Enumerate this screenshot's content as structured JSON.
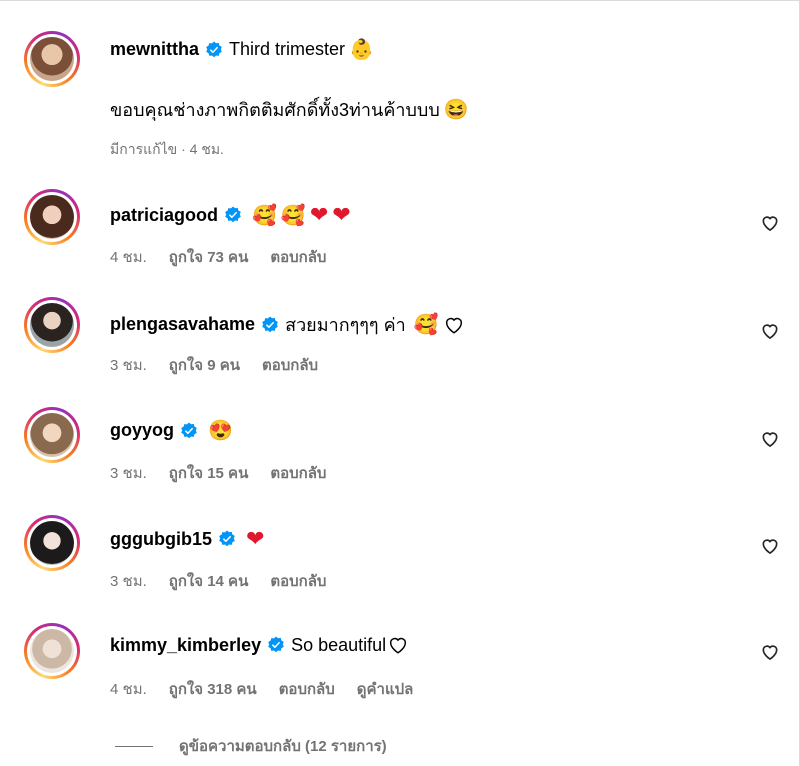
{
  "post": {
    "username": "mewnittha",
    "caption_title": "Third trimester",
    "caption_emoji": "👶",
    "caption_body": "ขอบคุณช่างภาพกิตติมศักดิ์ทั้ง3ท่านค้าบบบ",
    "caption_body_emoji": "😆",
    "edited_label": "มีการแก้ไข · 4 ชม."
  },
  "comments": [
    {
      "username": "patriciagood",
      "text": "",
      "emojis": [
        "🥰",
        "🥰"
      ],
      "hearts_red": 2,
      "hearts_outline": 0,
      "time": "4 ชม.",
      "likes": "ถูกใจ 73 คน",
      "reply": "ตอบกลับ",
      "translate": ""
    },
    {
      "username": "plengasavahame",
      "text": "สวยมากๆๆๆ ค่า",
      "emojis": [
        "🥰"
      ],
      "hearts_red": 0,
      "hearts_outline": 1,
      "time": "3 ชม.",
      "likes": "ถูกใจ 9 คน",
      "reply": "ตอบกลับ",
      "translate": ""
    },
    {
      "username": "goyyog",
      "text": "",
      "emojis": [
        "😍"
      ],
      "hearts_red": 0,
      "hearts_outline": 0,
      "time": "3 ชม.",
      "likes": "ถูกใจ 15 คน",
      "reply": "ตอบกลับ",
      "translate": ""
    },
    {
      "username": "gggubgib15",
      "text": "",
      "emojis": [],
      "hearts_red": 1,
      "hearts_outline": 0,
      "time": "3 ชม.",
      "likes": "ถูกใจ 14 คน",
      "reply": "ตอบกลับ",
      "translate": ""
    },
    {
      "username": "kimmy_kimberley",
      "text": "So beautiful",
      "emojis": [],
      "hearts_red": 0,
      "hearts_outline": 1,
      "time": "4 ชม.",
      "likes": "ถูกใจ 318 คน",
      "reply": "ตอบกลับ",
      "translate": "ดูคำแปล"
    }
  ],
  "view_replies": "ดูข้อความตอบกลับ (12 รายการ)",
  "colors": {
    "verified": "#0095f6",
    "meta": "#737373",
    "heart_red": "#e0182e"
  },
  "icons": {
    "verified": "verified-badge-icon",
    "like": "heart-outline-icon"
  }
}
